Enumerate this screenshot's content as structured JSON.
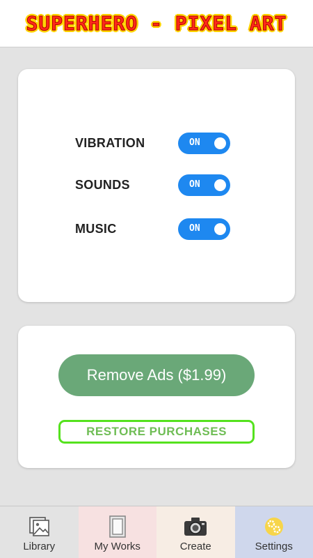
{
  "header": {
    "title": "Superhero - Pixel Art"
  },
  "settings": {
    "items": [
      {
        "label": "VIBRATION",
        "state": "ON"
      },
      {
        "label": "SOUNDS",
        "state": "ON"
      },
      {
        "label": "MUSIC",
        "state": "ON"
      }
    ]
  },
  "purchases": {
    "remove_ads_label": "Remove Ads ($1.99)",
    "restore_label": "RESTORE PURCHASES"
  },
  "tabs": [
    {
      "label": "Library",
      "icon": "library-icon",
      "color": "#e3e3e3"
    },
    {
      "label": "My Works",
      "icon": "frame-icon",
      "color": "#f7e1e1"
    },
    {
      "label": "Create",
      "icon": "camera-icon",
      "color": "#f7ede4"
    },
    {
      "label": "Settings",
      "icon": "gears-icon",
      "color": "#cfd7ec"
    }
  ],
  "colors": {
    "toggle_on": "#1e88f0",
    "remove_ads": "#6aa878",
    "restore_border": "#55e21e"
  }
}
